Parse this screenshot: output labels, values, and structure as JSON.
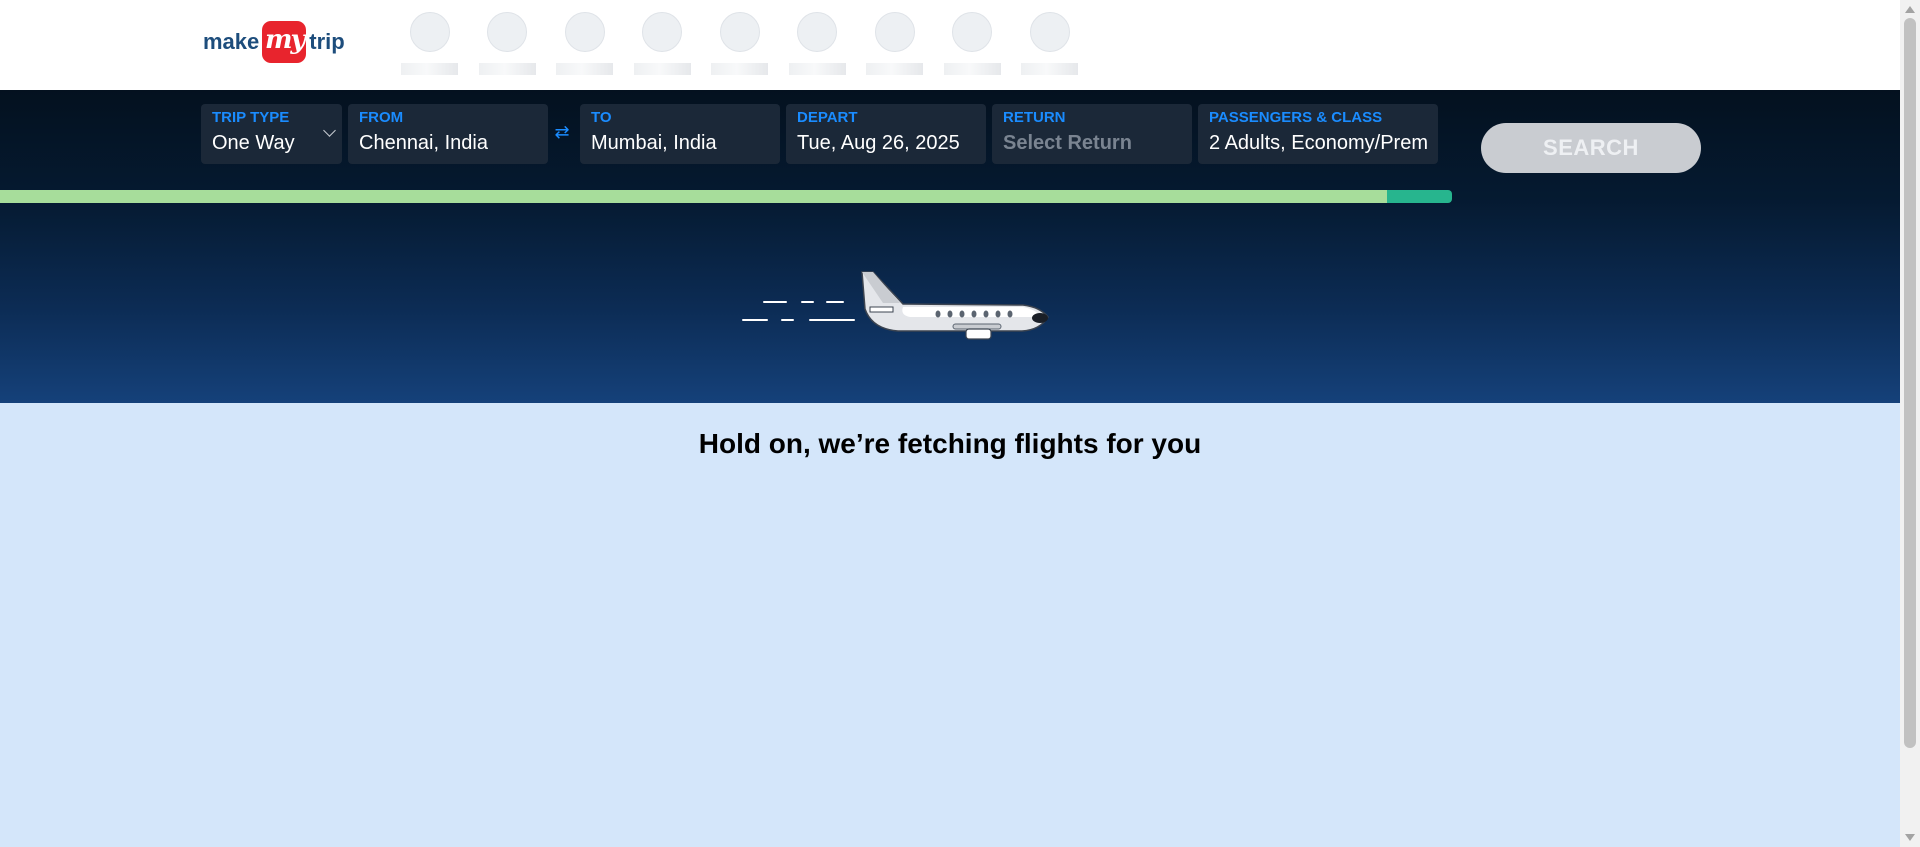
{
  "header": {
    "logo": {
      "make": "make",
      "my": "my",
      "trip": "trip"
    },
    "nav_skeleton_count": 9
  },
  "search": {
    "trip_type": {
      "label": "TRIP TYPE",
      "value": "One Way"
    },
    "from": {
      "label": "FROM",
      "value": "Chennai, India"
    },
    "swap_icon": "swap-arrows",
    "to": {
      "label": "TO",
      "value": "Mumbai, India"
    },
    "depart": {
      "label": "DEPART",
      "value": "Tue, Aug 26, 2025"
    },
    "return": {
      "label": "RETURN",
      "value": "Select Return"
    },
    "passengers": {
      "label": "PASSENGERS & CLASS",
      "value": "2 Adults, Economy/Prem"
    },
    "search_button": "SEARCH"
  },
  "progress": {
    "fraction": 0.955
  },
  "loading": {
    "message": "Hold on, we’re fetching flights for you"
  },
  "colors": {
    "accent": "#1a8cff",
    "brand_red": "#e8242d",
    "brand_blue": "#1d4d7c",
    "progress_done": "#a7dd9b",
    "progress_track": "#27b58e",
    "content_bg": "#d4e6fa"
  }
}
